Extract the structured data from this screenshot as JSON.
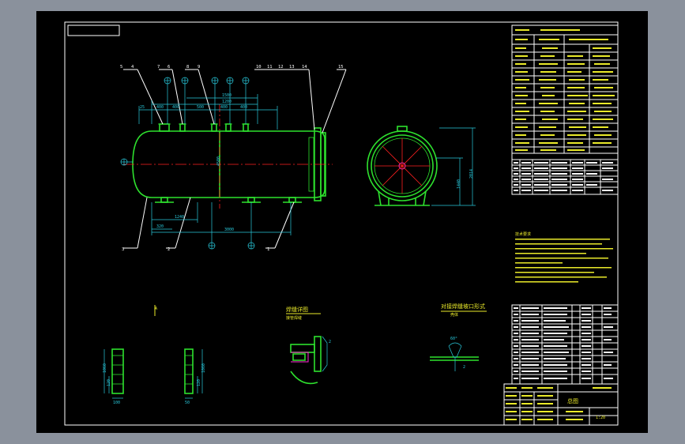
{
  "colors": {
    "background": "#8a919c",
    "drawing_bg": "#000000",
    "outline": "#2ee12e",
    "dimension": "#29c9dc",
    "centerline": "#ff2020",
    "text": "#eaea2a",
    "frame": "#ffffff",
    "nozzle": "#ff2bd6"
  },
  "leaders": {
    "top": [
      "5",
      "4",
      "7",
      "6",
      "8",
      "9",
      "10",
      "11",
      "12",
      "13",
      "14",
      "15"
    ],
    "bottom": [
      "3",
      "2",
      "1"
    ]
  },
  "dims": {
    "left_stub": "25",
    "seg_a": "400",
    "seg_b": "400",
    "seg_c": "500",
    "seg_d": "400",
    "seg_e": "400",
    "upper_top": "1500",
    "upper_mid": "1200",
    "bottom_a": "1240",
    "bottom_b": "320",
    "bottom_total": "3000",
    "shell_mark": "4500",
    "end_height": "2014",
    "end_inner": "1440",
    "support_h": "1060",
    "support_w1": "120",
    "support_w2": "100",
    "support_w3": "50",
    "weld_angle": "60°",
    "weld_gap": "2"
  },
  "detail_titles": {
    "support_front": "A",
    "weld_detail": "焊缝详图",
    "weld_sub": "接管焊缝",
    "joint_detail": "对接焊缝坡口形式",
    "joint_sub": "壳体"
  },
  "title_block": {
    "label": "总图",
    "scale": "1:20"
  },
  "notes_header": "技术要求"
}
